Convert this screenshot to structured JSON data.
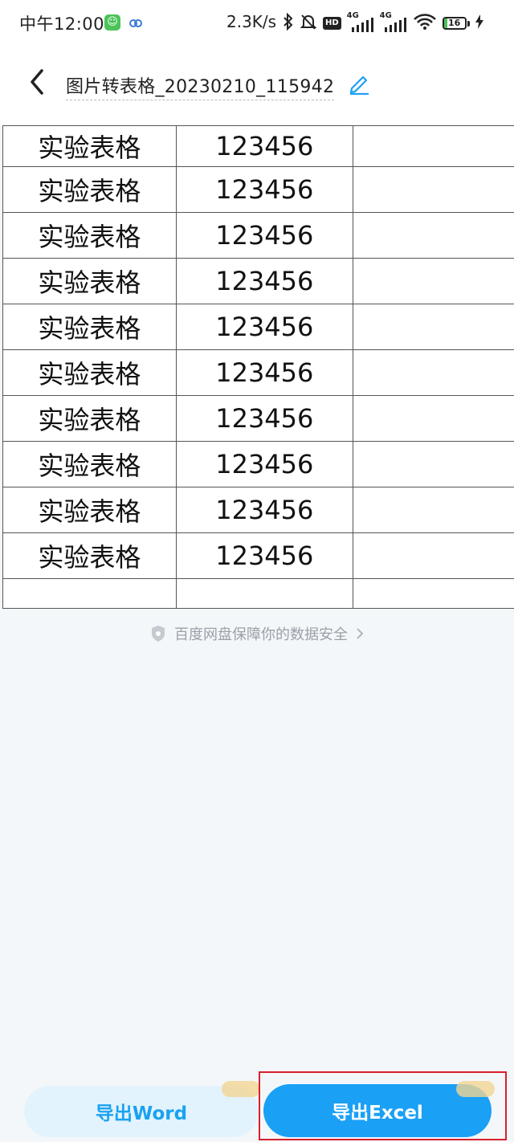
{
  "status_bar": {
    "time": "中午12:00",
    "speed": "2.3K/s",
    "hd_label": "HD",
    "net1": "4G",
    "net2": "4G",
    "battery": "16",
    "battery_level": 0.16
  },
  "header": {
    "title": "图片转表格_20230210_115942"
  },
  "table": {
    "rows": [
      [
        "实验表格",
        "123456",
        ""
      ],
      [
        "实验表格",
        "123456",
        ""
      ],
      [
        "实验表格",
        "123456",
        ""
      ],
      [
        "实验表格",
        "123456",
        ""
      ],
      [
        "实验表格",
        "123456",
        ""
      ],
      [
        "实验表格",
        "123456",
        ""
      ],
      [
        "实验表格",
        "123456",
        ""
      ],
      [
        "实验表格",
        "123456",
        ""
      ],
      [
        "实验表格",
        "123456",
        ""
      ],
      [
        "实验表格",
        "123456",
        ""
      ],
      [
        "",
        "",
        ""
      ]
    ]
  },
  "security_note": "百度网盘保障你的数据安全",
  "actions": {
    "export_word": "导出Word",
    "export_excel": "导出Excel"
  },
  "colors": {
    "accent": "#1aa0f5",
    "highlight": "#d8202b"
  }
}
